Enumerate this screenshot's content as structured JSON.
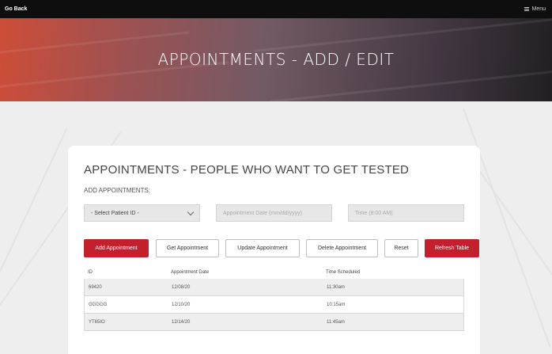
{
  "nav": {
    "back_label": "Go Back",
    "menu_label": "Menu",
    "menu_icon": "hamburger-icon"
  },
  "hero": {
    "title": "APPOINTMENTS - ADD / EDIT"
  },
  "card": {
    "title": "APPOINTMENTS - PEOPLE WHO WANT TO GET TESTED",
    "subtitle": "ADD APPOINTMENTS:",
    "patient_select": {
      "value": "- Select Patient ID -",
      "icon": "chevron-down-icon"
    },
    "date_input": {
      "placeholder": "Appointment Date (mm/dd/yyyy)"
    },
    "time_input": {
      "placeholder": "Time (8:00 AM)"
    },
    "buttons": [
      {
        "label": "Add Appointment",
        "style": "primary"
      },
      {
        "label": "Get Appointment",
        "style": "default"
      },
      {
        "label": "Update Appointment",
        "style": "default"
      },
      {
        "label": "Delete Appointment",
        "style": "default"
      },
      {
        "label": "Reset",
        "style": "default"
      },
      {
        "label": "Refresh Table",
        "style": "primary"
      }
    ],
    "table": {
      "headers": [
        "ID",
        "Appointment Date",
        "Time Scheduled"
      ],
      "rows": [
        [
          "69420",
          "12/08/20",
          "11:30am"
        ],
        [
          "GGGGG",
          "12/10/20",
          "10:15am"
        ],
        [
          "YT65IO",
          "12/14/20",
          "11:45am"
        ]
      ]
    }
  },
  "colors": {
    "accent": "#c41f2c",
    "topbar": "#0e0e0e",
    "background": "#eeeeee"
  }
}
